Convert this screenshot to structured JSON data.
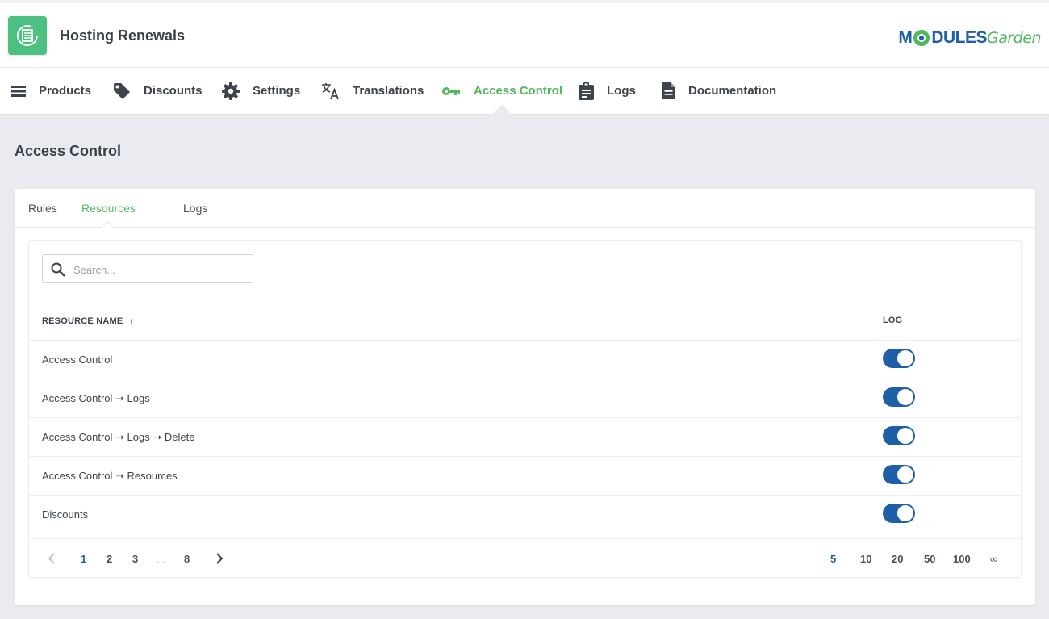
{
  "app": {
    "title": "Hosting Renewals",
    "brand_strong": "M",
    "brand_mid": "DULES",
    "brand_light": "Garden",
    "accent": "#54b85f",
    "primary": "#1e5fa8"
  },
  "nav": {
    "items": [
      {
        "label": "Products",
        "icon": "list-icon"
      },
      {
        "label": "Discounts",
        "icon": "tag-icon"
      },
      {
        "label": "Settings",
        "icon": "gear-icon"
      },
      {
        "label": "Translations",
        "icon": "translate-icon"
      },
      {
        "label": "Access Control",
        "icon": "key-icon",
        "active": true
      },
      {
        "label": "Logs",
        "icon": "clipboard-icon"
      },
      {
        "label": "Documentation",
        "icon": "document-icon"
      }
    ]
  },
  "page": {
    "title": "Access Control"
  },
  "tabs": [
    {
      "label": "Rules"
    },
    {
      "label": "Resources",
      "active": true
    },
    {
      "label": "Logs"
    }
  ],
  "search": {
    "placeholder": "Search...",
    "value": ""
  },
  "table": {
    "columns": [
      "RESOURCE NAME",
      "LOG"
    ],
    "sort_indicator": "↑",
    "rows": [
      {
        "name": "Access Control",
        "log": true
      },
      {
        "name": "Access Control ➝ Logs",
        "log": true
      },
      {
        "name": "Access Control ➝ Logs ➝ Delete",
        "log": true
      },
      {
        "name": "Access Control ➝ Resources",
        "log": true
      },
      {
        "name": "Discounts",
        "log": true
      }
    ]
  },
  "pagination": {
    "pages": [
      "1",
      "2",
      "3",
      "...",
      "8"
    ],
    "current_page": "1",
    "page_sizes": [
      "5",
      "10",
      "20",
      "50",
      "100",
      "∞"
    ],
    "current_size": "5"
  }
}
